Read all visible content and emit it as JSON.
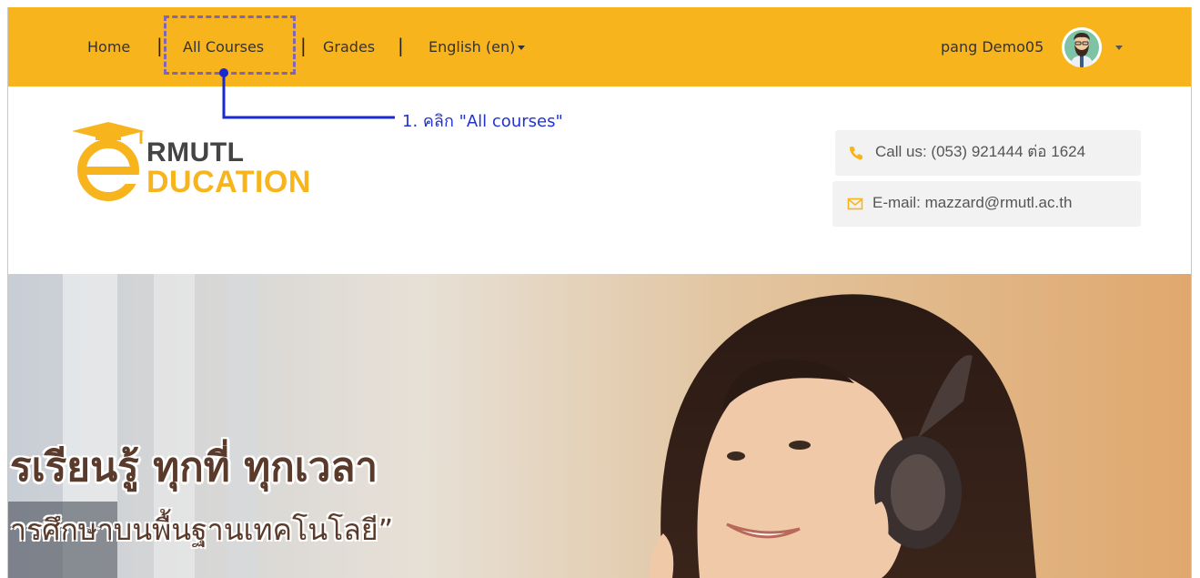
{
  "nav": {
    "items": [
      {
        "label": "Home"
      },
      {
        "label": "All Courses"
      },
      {
        "label": "Grades"
      },
      {
        "label": "English (en)"
      }
    ],
    "separator": "|"
  },
  "user": {
    "name": "pang Demo05",
    "avatar_icon": "bearded-man-avatar"
  },
  "annotation": {
    "text": "1. คลิก \"All courses\"",
    "color": "#1a2ad0",
    "highlight_color": "#8066b2"
  },
  "logo": {
    "line1": "RMUTL",
    "line2": "DUCATION",
    "brand_color": "#f8b41c"
  },
  "contacts": {
    "phone": {
      "icon": "phone-icon",
      "text": "Call us: (053) 921444 ต่อ 1624"
    },
    "email": {
      "icon": "envelope-icon",
      "text": "E-mail: mazzard@rmutl.ac.th"
    }
  },
  "hero": {
    "line1": "รเรียนรู้ ทุกที่ ทุกเวลา",
    "line2": "ารศึกษาบนพื้นฐานเทคโนโลยี”"
  },
  "colors": {
    "topbar": "#f8b41c",
    "contact_icon": "#f8b41c"
  }
}
